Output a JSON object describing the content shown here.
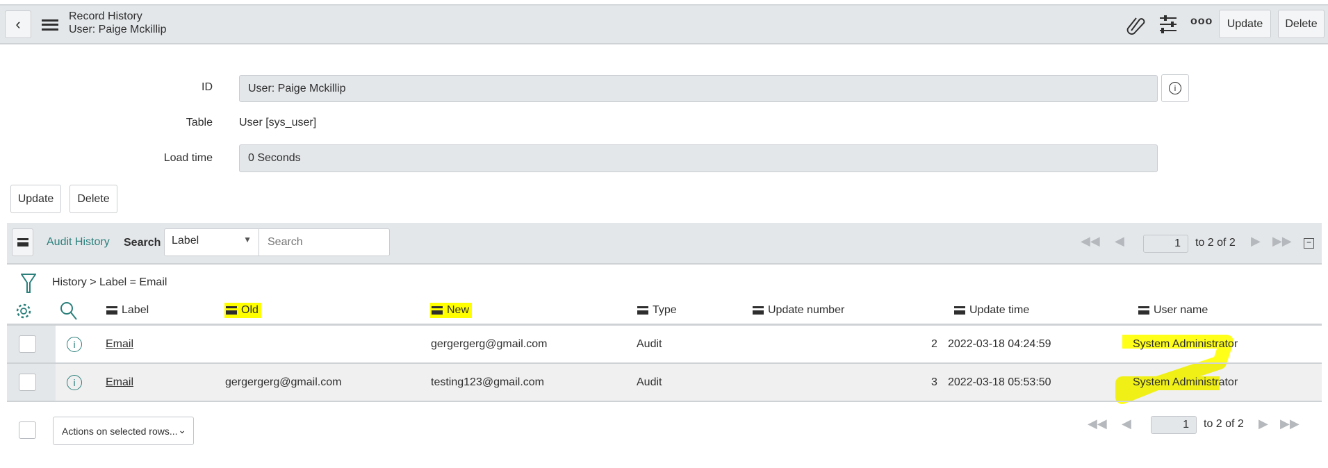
{
  "header": {
    "title": "Record History",
    "subtitle": "User: Paige Mckillip",
    "update": "Update",
    "delete": "Delete"
  },
  "form": {
    "id_label": "ID",
    "id_value": "User: Paige Mckillip",
    "table_label": "Table",
    "table_value": "User [sys_user]",
    "load_label": "Load time",
    "load_value": "0 Seconds"
  },
  "buttons": {
    "update": "Update",
    "delete": "Delete"
  },
  "list": {
    "title": "Audit History",
    "search_label": "Search",
    "search_field": "Label",
    "search_placeholder": "Search",
    "page": "1",
    "range": "to 2 of 2"
  },
  "breadcrumb": {
    "root": "History",
    "sep": ">",
    "filter": "Label = Email"
  },
  "columns": [
    "Label",
    "Old",
    "New",
    "Type",
    "Update number",
    "Update time",
    "User name"
  ],
  "rows": [
    {
      "label": "Email",
      "old": "",
      "new": "gergergerg@gmail.com",
      "type": "Audit",
      "update_number": "2",
      "update_time": "2022-03-18 04:24:59",
      "user": "System Administrator"
    },
    {
      "label": "Email",
      "old": "gergergerg@gmail.com",
      "new": "testing123@gmail.com",
      "type": "Audit",
      "update_number": "3",
      "update_time": "2022-03-18 05:53:50",
      "user": "System Administrator"
    }
  ],
  "footer": {
    "actions": "Actions on selected rows...",
    "page": "1",
    "range": "to 2 of 2"
  },
  "colors": {
    "accent": "#2a7f7b",
    "highlight": "#ffff00",
    "bar": "#e4e7ea"
  }
}
